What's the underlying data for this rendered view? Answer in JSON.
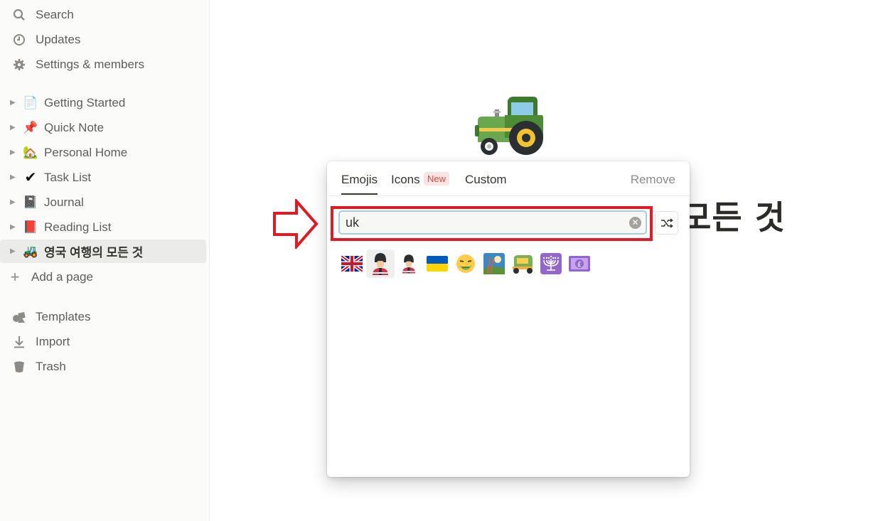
{
  "sidebar": {
    "nav": [
      {
        "label": "Search",
        "icon": "search-icon"
      },
      {
        "label": "Updates",
        "icon": "clock-icon"
      },
      {
        "label": "Settings & members",
        "icon": "gear-icon"
      }
    ],
    "pages": [
      {
        "label": "Getting Started",
        "emoji": "📄"
      },
      {
        "label": "Quick Note",
        "emoji": "📌"
      },
      {
        "label": "Personal Home",
        "emoji": "🏡"
      },
      {
        "label": "Task List",
        "emoji": "✔"
      },
      {
        "label": "Journal",
        "emoji": "📓"
      },
      {
        "label": "Reading List",
        "emoji": "📕"
      },
      {
        "label": "영국 여행의 모든 것",
        "emoji": "🚜",
        "active": true
      }
    ],
    "add_page": "Add a page",
    "bottom": [
      {
        "label": "Templates",
        "icon": "templates-icon"
      },
      {
        "label": "Import",
        "icon": "import-icon"
      },
      {
        "label": "Trash",
        "icon": "trash-icon"
      }
    ]
  },
  "main": {
    "page_icon": "tractor",
    "title_visible": "모든 것"
  },
  "picker": {
    "tabs": {
      "emojis": "Emojis",
      "icons": "Icons",
      "new_badge": "New",
      "custom": "Custom"
    },
    "remove": "Remove",
    "search_value": "uk",
    "results": [
      "gb-flag",
      "guard",
      "guard-small",
      "ukraine-flag",
      "nauseated-face",
      "rice-scene",
      "auto-rickshaw",
      "menorah",
      "pound-banknote"
    ]
  },
  "colors": {
    "highlight": "#e01b24",
    "sidebar_bg": "#fbfbfa"
  }
}
